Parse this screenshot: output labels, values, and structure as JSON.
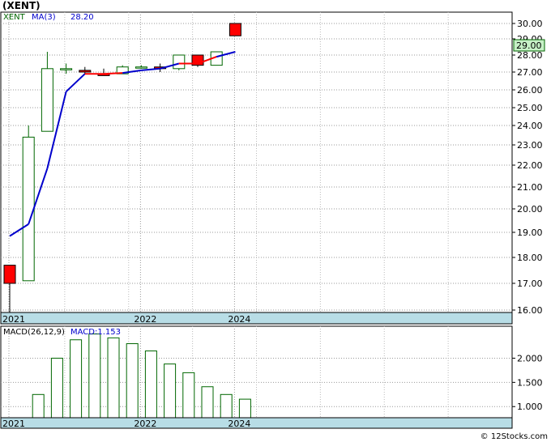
{
  "page": {
    "title": "(XENT)",
    "footer": "© 12Stocks.com"
  },
  "chart_data": [
    {
      "type": "candlestick",
      "legend": {
        "symbol": "XENT",
        "ma_label": "MA(3)",
        "ma_value": "28.20"
      },
      "last_price_label": "29.00",
      "y_ticks": [
        16,
        17,
        18,
        19,
        20,
        21,
        22,
        23,
        24,
        25,
        26,
        27,
        28,
        29,
        30
      ],
      "y_tick_labels": [
        "16.00",
        "17.00",
        "18.00",
        "19.00",
        "20.00",
        "21.00",
        "22.00",
        "23.00",
        "24.00",
        "25.00",
        "26.00",
        "27.00",
        "28.00",
        "29.00",
        "30.00"
      ],
      "x_labels": [
        "2021",
        "2022",
        "2024"
      ],
      "x_label_positions": [
        0,
        7,
        12
      ],
      "candles": [
        {
          "o": 17.7,
          "h": 17.7,
          "l": 15.9,
          "c": 17.0
        },
        {
          "o": 17.1,
          "h": 24.0,
          "l": 17.1,
          "c": 23.4
        },
        {
          "o": 23.7,
          "h": 28.2,
          "l": 23.7,
          "c": 27.2
        },
        {
          "o": 27.2,
          "h": 27.5,
          "l": 26.9,
          "c": 27.2
        },
        {
          "o": 27.1,
          "h": 27.3,
          "l": 26.9,
          "c": 27.0
        },
        {
          "o": 26.9,
          "h": 27.2,
          "l": 26.8,
          "c": 26.8
        },
        {
          "o": 26.9,
          "h": 27.4,
          "l": 26.9,
          "c": 27.3
        },
        {
          "o": 27.3,
          "h": 27.4,
          "l": 27.2,
          "c": 27.3
        },
        {
          "o": 27.3,
          "h": 27.5,
          "l": 27.0,
          "c": 27.2
        },
        {
          "o": 27.2,
          "h": 28.0,
          "l": 27.1,
          "c": 28.0
        },
        {
          "o": 28.0,
          "h": 28.0,
          "l": 27.3,
          "c": 27.4
        },
        {
          "o": 27.4,
          "h": 28.2,
          "l": 27.4,
          "c": 28.2
        },
        {
          "o": 30.0,
          "h": 30.0,
          "l": 29.2,
          "c": 29.2
        }
      ],
      "ma": [
        18.85,
        19.35,
        21.85,
        25.9,
        26.9,
        26.9,
        26.95,
        27.1,
        27.2,
        27.5,
        27.5,
        27.9,
        28.2
      ],
      "ma_colors": [
        "#0000cc",
        "#0000cc",
        "#0000cc",
        "#0000cc",
        "#ff0000",
        "#ff0000",
        "#0000cc",
        "#0000cc",
        "#0000cc",
        "#ff0000",
        "#ff0000",
        "#0000cc"
      ],
      "colors": {
        "up": "#006600",
        "down": "#cc0000",
        "down_fill": "#ff0000",
        "ma": "#0000cc"
      }
    },
    {
      "type": "bar",
      "legend": {
        "label": "MACD(26,12,9)",
        "value_label": "MACD:1.153"
      },
      "y_ticks": [
        1.0,
        1.5,
        2.0
      ],
      "y_tick_labels": [
        "1.000",
        "1.500",
        "2.000"
      ],
      "x_labels": [
        "2021",
        "2022",
        "2024"
      ],
      "x_label_positions": [
        0,
        7,
        12
      ],
      "values": [
        null,
        1.25,
        2.0,
        2.38,
        2.5,
        2.42,
        2.3,
        2.15,
        1.88,
        1.7,
        1.41,
        1.25,
        1.153
      ],
      "ylim": [
        0.77,
        2.66
      ],
      "colors": {
        "bar": "#006600"
      }
    }
  ]
}
